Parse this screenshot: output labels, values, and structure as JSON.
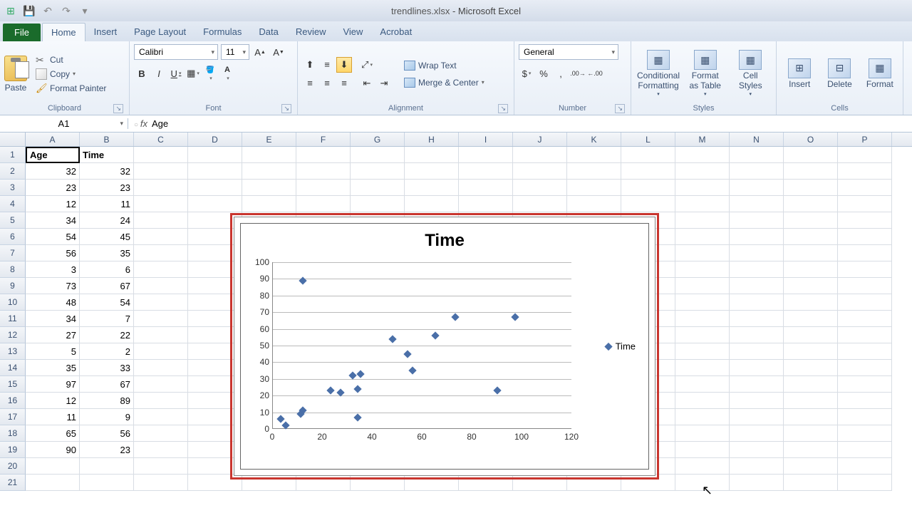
{
  "app": {
    "document": "trendlines.xlsx",
    "name": "Microsoft Excel"
  },
  "qat": [
    "excel-icon",
    "save-icon",
    "undo-icon",
    "redo-icon",
    "more-icon"
  ],
  "tabs": {
    "file": "File",
    "items": [
      "Home",
      "Insert",
      "Page Layout",
      "Formulas",
      "Data",
      "Review",
      "View",
      "Acrobat"
    ],
    "active": "Home"
  },
  "ribbon": {
    "clipboard": {
      "label": "Clipboard",
      "paste": "Paste",
      "cut": "Cut",
      "copy": "Copy",
      "format_painter": "Format Painter"
    },
    "font": {
      "label": "Font",
      "name": "Calibri",
      "size": "11"
    },
    "alignment": {
      "label": "Alignment",
      "wrap": "Wrap Text",
      "merge": "Merge & Center"
    },
    "number": {
      "label": "Number",
      "format": "General"
    },
    "styles": {
      "label": "Styles",
      "conditional": "Conditional Formatting",
      "as_table": "Format as Table",
      "cell_styles": "Cell Styles"
    },
    "cells": {
      "label": "Cells",
      "insert": "Insert",
      "delete": "Delete",
      "format": "Format"
    }
  },
  "formula_bar": {
    "name_box": "A1",
    "value": "Age"
  },
  "columns": [
    "A",
    "B",
    "C",
    "D",
    "E",
    "F",
    "G",
    "H",
    "I",
    "J",
    "K",
    "L",
    "M",
    "N",
    "O",
    "P"
  ],
  "row_count": 21,
  "headers": {
    "A": "Age",
    "B": "Time"
  },
  "table": [
    [
      32,
      32
    ],
    [
      23,
      23
    ],
    [
      12,
      11
    ],
    [
      34,
      24
    ],
    [
      54,
      45
    ],
    [
      56,
      35
    ],
    [
      3,
      6
    ],
    [
      73,
      67
    ],
    [
      48,
      54
    ],
    [
      34,
      7
    ],
    [
      27,
      22
    ],
    [
      5,
      2
    ],
    [
      35,
      33
    ],
    [
      97,
      67
    ],
    [
      12,
      89
    ],
    [
      11,
      9
    ],
    [
      65,
      56
    ],
    [
      90,
      23
    ]
  ],
  "active_cell": "A1",
  "chart_data": {
    "type": "scatter",
    "title": "Time",
    "xlabel": "",
    "ylabel": "",
    "xlim": [
      0,
      120
    ],
    "ylim": [
      0,
      100
    ],
    "xticks": [
      0,
      20,
      40,
      60,
      80,
      100,
      120
    ],
    "yticks": [
      0,
      10,
      20,
      30,
      40,
      50,
      60,
      70,
      80,
      90,
      100
    ],
    "series": [
      {
        "name": "Time",
        "x": [
          32,
          23,
          12,
          34,
          54,
          56,
          3,
          73,
          48,
          34,
          27,
          5,
          35,
          97,
          12,
          11,
          65,
          90
        ],
        "y": [
          32,
          23,
          11,
          24,
          45,
          35,
          6,
          67,
          54,
          7,
          22,
          2,
          33,
          67,
          89,
          9,
          56,
          23
        ]
      }
    ],
    "legend": "Time"
  }
}
